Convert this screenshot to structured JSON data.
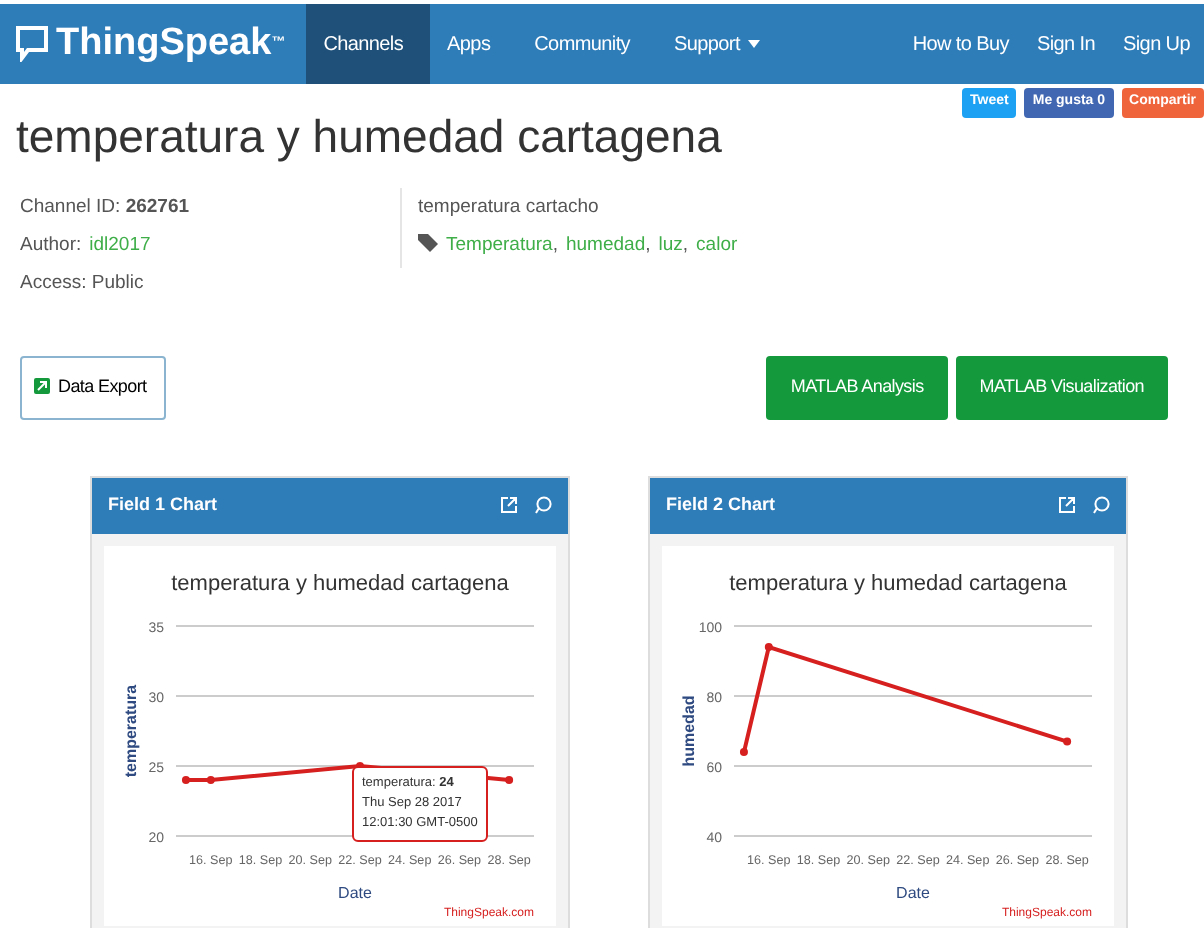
{
  "navbar": {
    "brand": "ThingSpeak",
    "brand_mark": "™",
    "items": [
      {
        "label": "Channels",
        "selected": true,
        "dropdown": false
      },
      {
        "label": "Apps",
        "selected": false,
        "dropdown": false
      },
      {
        "label": "Community",
        "selected": false,
        "dropdown": false
      },
      {
        "label": "Support",
        "selected": false,
        "dropdown": true
      }
    ],
    "right_items": [
      "How to Buy",
      "Sign In",
      "Sign Up"
    ]
  },
  "social": [
    {
      "kind": "tweet",
      "label": "Tweet"
    },
    {
      "kind": "like",
      "label": "Me gusta 0"
    },
    {
      "kind": "share",
      "label": "Compartir"
    }
  ],
  "title": "temperatura y humedad cartagena",
  "info": {
    "channel_id_label": "Channel ID:",
    "channel_id": "262761",
    "author_label": "Author:",
    "author": "idl2017",
    "access": "Access: Public",
    "description": "temperatura cartacho",
    "tags": [
      "Temperatura",
      "humedad",
      "luz",
      "calor"
    ],
    "tag_separator": ","
  },
  "buttons": {
    "export": "Data Export",
    "actions": [
      "MATLAB Analysis",
      "MATLAB Visualization"
    ]
  },
  "panels": [
    {
      "title": "Field 1 Chart",
      "credit": "ThingSpeak.com",
      "tooltip": {
        "separator": ":",
        "value": "24",
        "lines": [
          "Thu Sep 28 2017",
          "12:01:30 GMT-0500"
        ]
      },
      "chart_data": {
        "type": "line",
        "title": "temperatura y humedad cartagena",
        "xlabel": "Date",
        "ylabel": "temperatura",
        "categories": [
          null,
          "16. Sep",
          null,
          "18. Sep",
          null,
          "20. Sep",
          null,
          "22. Sep",
          null,
          "24. Sep",
          null,
          "26. Sep",
          null,
          "28. Sep",
          null
        ],
        "series": [
          {
            "name": "temperatura",
            "color": "#d62020",
            "values": [
              24,
              24,
              null,
              null,
              null,
              null,
              null,
              25,
              null,
              null,
              null,
              null,
              null,
              24,
              null
            ],
            "marker": true
          }
        ],
        "ylim": [
          20,
          35
        ],
        "yticks": [
          20,
          25,
          30,
          35
        ]
      }
    },
    {
      "title": "Field 2 Chart",
      "credit": "ThingSpeak.com",
      "chart_data": {
        "type": "line",
        "title": "temperatura y humedad cartagena",
        "xlabel": "Date",
        "ylabel": "humedad",
        "categories": [
          null,
          "16. Sep",
          null,
          "18. Sep",
          null,
          "20. Sep",
          null,
          "22. Sep",
          null,
          "24. Sep",
          null,
          "26. Sep",
          null,
          "28. Sep",
          null
        ],
        "series": [
          {
            "color": "#d62020",
            "values": [
              64,
              94,
              null,
              null,
              null,
              null,
              null,
              null,
              null,
              null,
              null,
              null,
              null,
              67,
              null
            ],
            "marker": true
          }
        ],
        "ylim": [
          40,
          100
        ],
        "yticks": [
          40,
          60,
          80,
          100
        ]
      }
    }
  ]
}
